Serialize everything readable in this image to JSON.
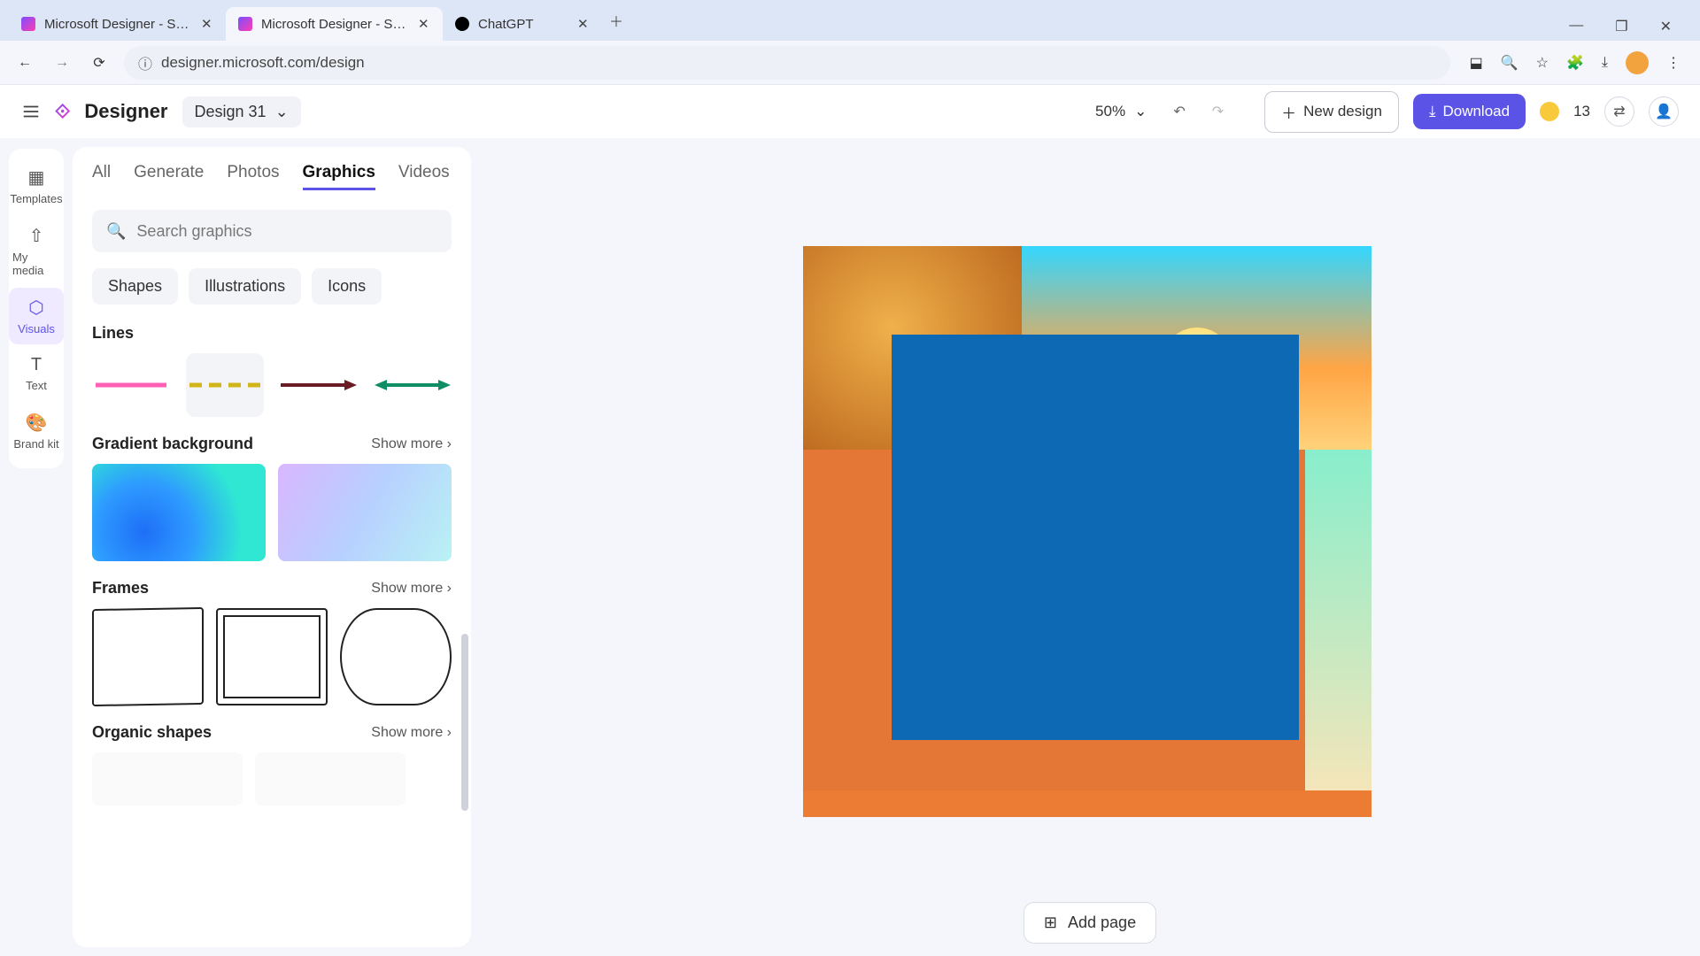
{
  "browser": {
    "tabs": [
      {
        "title": "Microsoft Designer - Stunning"
      },
      {
        "title": "Microsoft Designer - Stunning"
      },
      {
        "title": "ChatGPT"
      }
    ],
    "url": "designer.microsoft.com/design"
  },
  "app": {
    "brand": "Designer",
    "title": "Design 31",
    "zoom": "50%",
    "new_design": "New design",
    "download": "Download",
    "coins": "13"
  },
  "rails": [
    {
      "label": "Templates"
    },
    {
      "label": "My media"
    },
    {
      "label": "Visuals"
    },
    {
      "label": "Text"
    },
    {
      "label": "Brand kit"
    }
  ],
  "panel": {
    "tabs": [
      "All",
      "Generate",
      "Photos",
      "Graphics",
      "Videos"
    ],
    "active_tab": "Graphics",
    "search_placeholder": "Search graphics",
    "chips": [
      "Shapes",
      "Illustrations",
      "Icons"
    ],
    "sections": {
      "lines": "Lines",
      "gradient": "Gradient background",
      "frames": "Frames",
      "organic": "Organic shapes"
    },
    "show_more": "Show more"
  },
  "canvas": {
    "add_page": "Add page"
  }
}
